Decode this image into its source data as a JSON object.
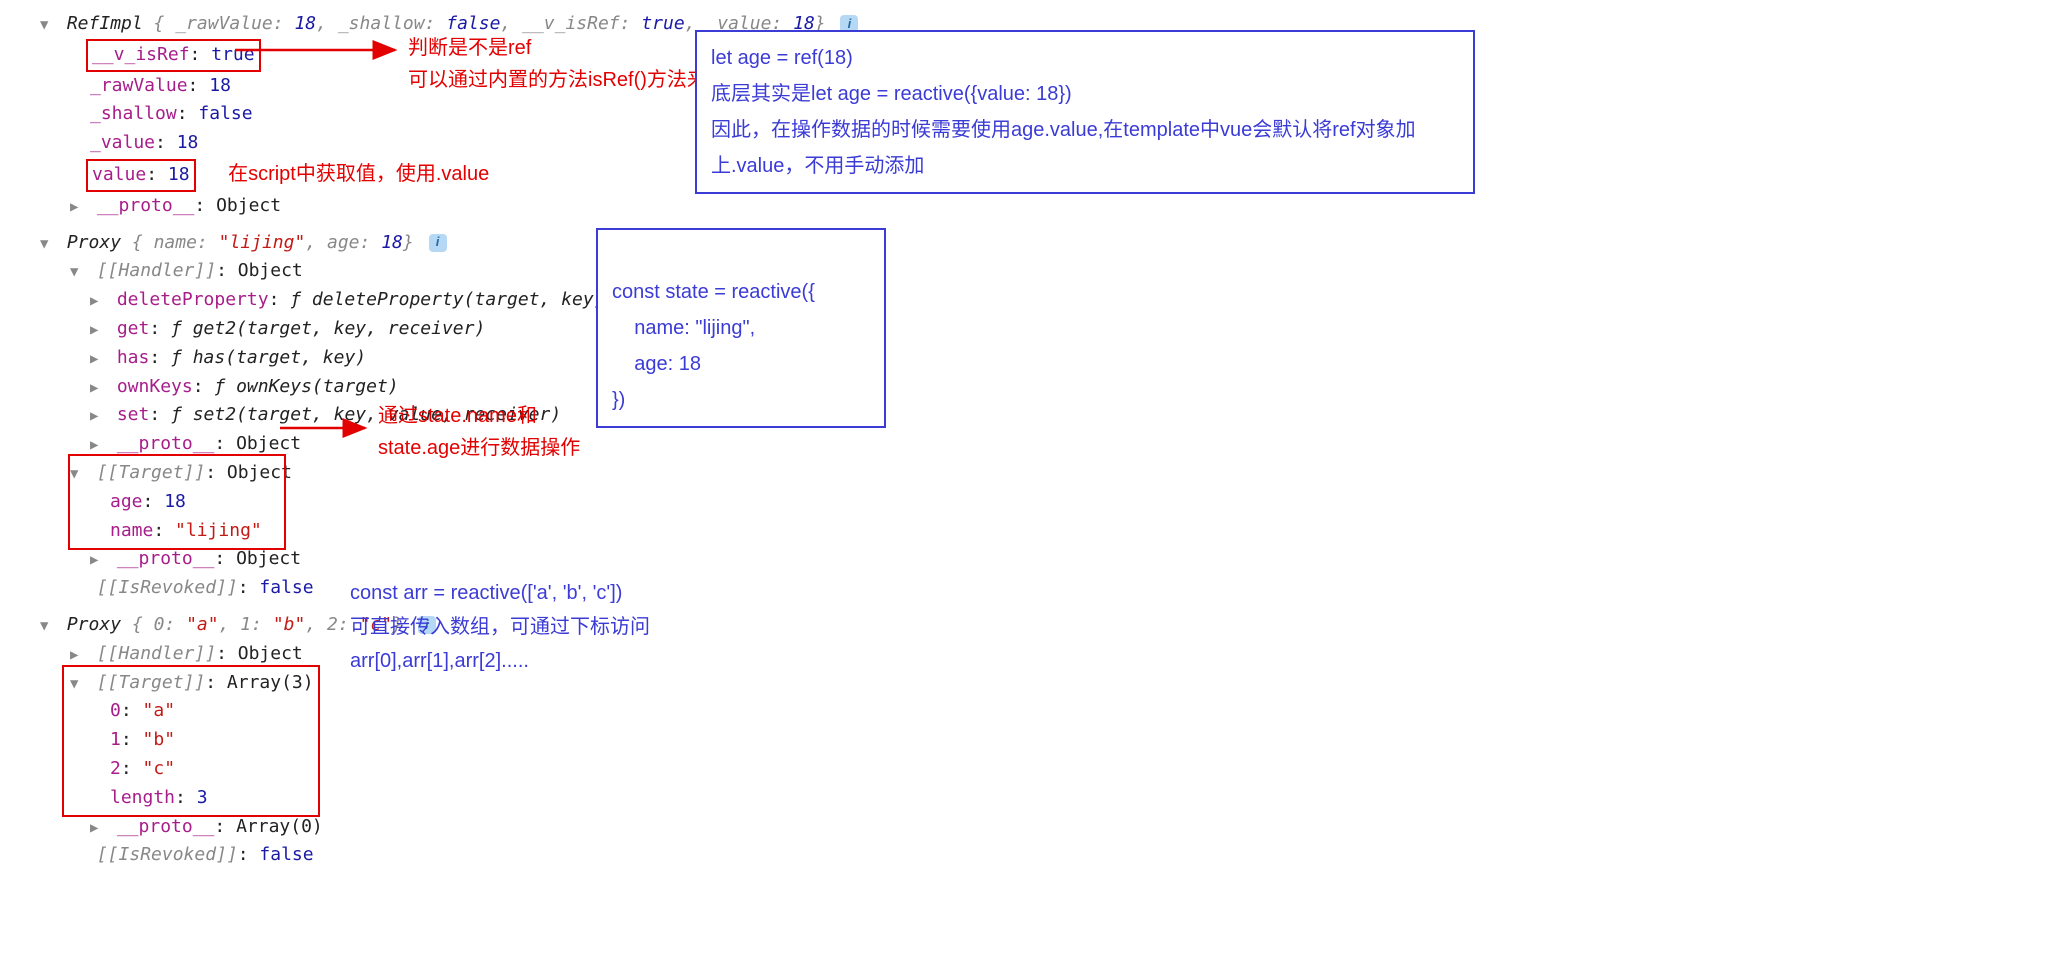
{
  "section1": {
    "header": {
      "cls": "RefImpl",
      "p1k": "_rawValue",
      "p1v": "18",
      "p2k": "_shallow",
      "p2v": "false",
      "p3k": "__v_isRef",
      "p3v": "true",
      "p4k": "_value",
      "p4v": "18"
    },
    "line_isRef_k": "__v_isRef",
    "line_isRef_v": "true",
    "line_raw_k": "_rawValue",
    "line_raw_v": "18",
    "line_shallow_k": "_shallow",
    "line_shallow_v": "false",
    "line_value_k": "_value",
    "line_value_v": "18",
    "line_val_k": "value",
    "line_val_v": "18",
    "line_proto_k": "__proto__",
    "line_proto_v": "Object",
    "anno_isRef1": "判断是不是ref",
    "anno_isRef2": "可以通过内置的方法isRef()方法来判断",
    "anno_value": "在script中获取值，使用.value",
    "bluebox1_l1": "let age = ref(18)",
    "bluebox1_l2": "底层其实是let age = reactive({value: 18})",
    "bluebox1_l3": "因此，在操作数据的时候需要使用age.value,在template中vue会默认将ref对象加上.value，不用手动添加"
  },
  "section2": {
    "header": {
      "cls": "Proxy",
      "p1k": "name",
      "p1v": "\"lijing\"",
      "p2k": "age",
      "p2v": "18"
    },
    "handler_label": "[[Handler]]",
    "handler_val": "Object",
    "h_del_k": "deleteProperty",
    "h_del_v": "ƒ deleteProperty(target, key)",
    "h_get_k": "get",
    "h_get_v": "ƒ get2(target, key, receiver)",
    "h_has_k": "has",
    "h_has_v": "ƒ has(target, key)",
    "h_own_k": "ownKeys",
    "h_own_v": "ƒ ownKeys(target)",
    "h_set_k": "set",
    "h_set_v": "ƒ set2(target, key, value, receiver)",
    "h_proto_k": "__proto__",
    "h_proto_v": "Object",
    "target_label": "[[Target]]",
    "target_val": "Object",
    "t_age_k": "age",
    "t_age_v": "18",
    "t_name_k": "name",
    "t_name_v": "\"lijing\"",
    "t_proto_k": "__proto__",
    "t_proto_v": "Object",
    "revoked_label": "[[IsRevoked]]",
    "revoked_val": "false",
    "bluebox2_l1": "const state = reactive({",
    "bluebox2_l2": "    name: \"lijing\",",
    "bluebox2_l3": "    age: 18",
    "bluebox2_l4": "})",
    "anno_target1": "通过state.name和",
    "anno_target2": "state.age进行数据操作"
  },
  "section3": {
    "header": {
      "cls": "Proxy",
      "p1k": "0",
      "p1v": "\"a\"",
      "p2k": "1",
      "p2v": "\"b\"",
      "p3k": "2",
      "p3v": "\"c\""
    },
    "handler_label": "[[Handler]]",
    "handler_val": "Object",
    "target_label": "[[Target]]",
    "target_val": "Array(3)",
    "t0k": "0",
    "t0v": "\"a\"",
    "t1k": "1",
    "t1v": "\"b\"",
    "t2k": "2",
    "t2v": "\"c\"",
    "tlen_k": "length",
    "tlen_v": "3",
    "t_proto_k": "__proto__",
    "t_proto_v": "Array(0)",
    "revoked_label": "[[IsRevoked]]",
    "revoked_val": "false",
    "note_l1": "const arr = reactive(['a', 'b', 'c'])",
    "note_l2": "可直接传入数组，可通过下标访问",
    "note_l3": "arr[0],arr[1],arr[2]....."
  }
}
